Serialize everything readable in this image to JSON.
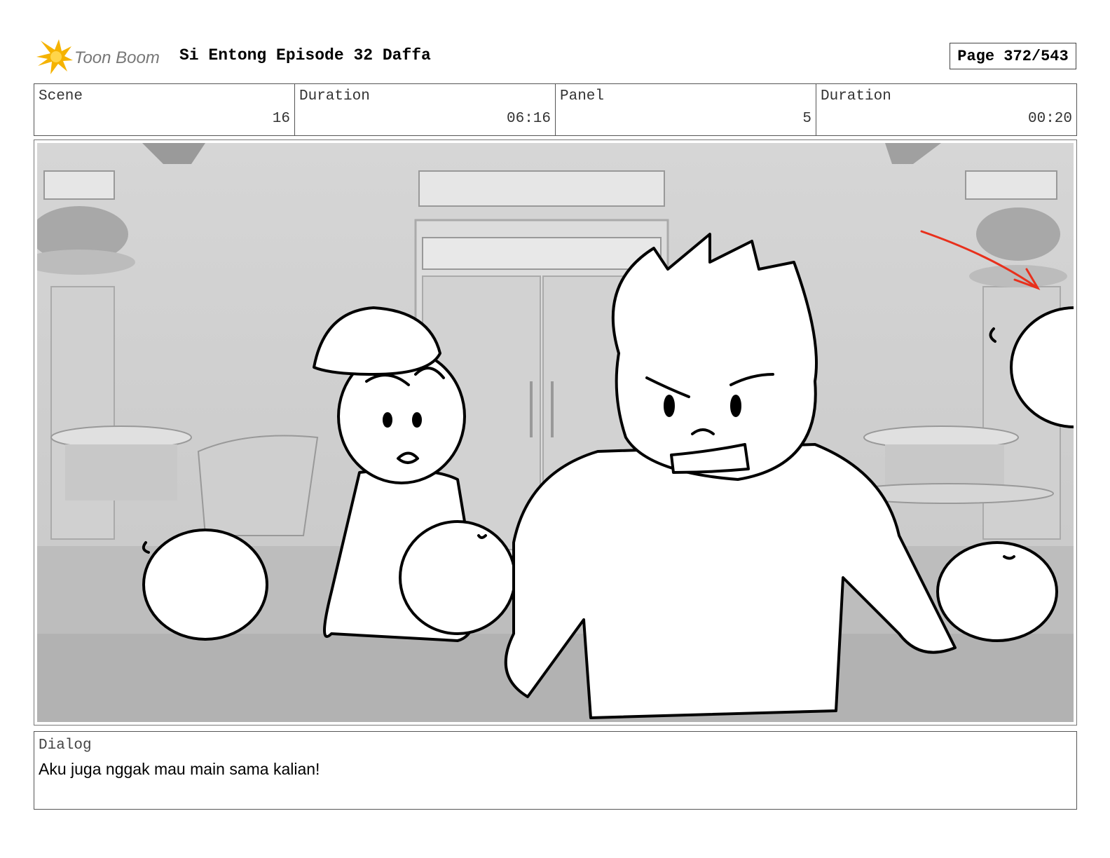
{
  "header": {
    "logo_text": "Toon Boom",
    "title": "Si Entong Episode 32 Daffa",
    "page": "Page 372/543"
  },
  "info": {
    "scene_label": "Scene",
    "scene_value": "16",
    "scene_duration_label": "Duration",
    "scene_duration_value": "06:16",
    "panel_label": "Panel",
    "panel_value": "5",
    "panel_duration_label": "Duration",
    "panel_duration_value": "00:20"
  },
  "dialog": {
    "label": "Dialog",
    "text": "Aku juga nggak mau main sama kalian!"
  },
  "colors": {
    "logo_yellow": "#f5b301",
    "arrow_red": "#e8301c",
    "background_gray": "#cfcfcf"
  }
}
